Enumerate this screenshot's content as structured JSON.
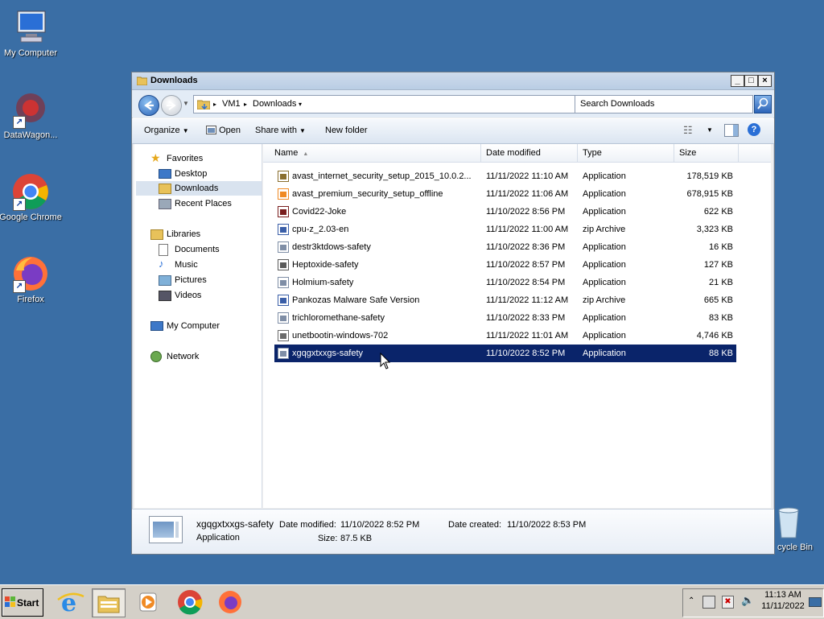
{
  "desktop": {
    "icons": [
      {
        "label": "My Computer"
      },
      {
        "label": "DataWagon..."
      },
      {
        "label": "Google Chrome"
      },
      {
        "label": "Firefox"
      },
      {
        "label": "cycle Bin"
      }
    ]
  },
  "window": {
    "title": "Downloads",
    "address": {
      "root": "VM1",
      "current": "Downloads"
    },
    "search_placeholder": "Search Downloads",
    "toolbar": {
      "organize": "Organize",
      "open": "Open",
      "share_with": "Share with",
      "new_folder": "New folder"
    },
    "nav": {
      "favorites": "Favorites",
      "desktop": "Desktop",
      "downloads": "Downloads",
      "recent_places": "Recent Places",
      "libraries": "Libraries",
      "documents": "Documents",
      "music": "Music",
      "pictures": "Pictures",
      "videos": "Videos",
      "my_computer": "My Computer",
      "network": "Network"
    },
    "columns": {
      "name": "Name",
      "date_modified": "Date modified",
      "type": "Type",
      "size": "Size"
    },
    "files": [
      {
        "name": "avast_internet_security_setup_2015_10.0.2...",
        "date": "11/11/2022 11:10 AM",
        "type": "Application",
        "size": "178,519 KB"
      },
      {
        "name": "avast_premium_security_setup_offline",
        "date": "11/11/2022 11:06 AM",
        "type": "Application",
        "size": "678,915 KB"
      },
      {
        "name": "Covid22-Joke",
        "date": "11/10/2022 8:56 PM",
        "type": "Application",
        "size": "622 KB"
      },
      {
        "name": "cpu-z_2.03-en",
        "date": "11/11/2022 11:00 AM",
        "type": "zip Archive",
        "size": "3,323 KB"
      },
      {
        "name": "destr3ktdows-safety",
        "date": "11/10/2022 8:36 PM",
        "type": "Application",
        "size": "16 KB"
      },
      {
        "name": "Heptoxide-safety",
        "date": "11/10/2022 8:57 PM",
        "type": "Application",
        "size": "127 KB"
      },
      {
        "name": "Holmium-safety",
        "date": "11/10/2022 8:54 PM",
        "type": "Application",
        "size": "21 KB"
      },
      {
        "name": "Pankozas Malware Safe Version",
        "date": "11/11/2022 11:12 AM",
        "type": "zip Archive",
        "size": "665 KB"
      },
      {
        "name": "trichloromethane-safety",
        "date": "11/10/2022 8:33 PM",
        "type": "Application",
        "size": "83 KB"
      },
      {
        "name": "unetbootin-windows-702",
        "date": "11/11/2022 11:01 AM",
        "type": "Application",
        "size": "4,746 KB"
      },
      {
        "name": "xgqgxtxxgs-safety",
        "date": "11/10/2022 8:52 PM",
        "type": "Application",
        "size": "88 KB"
      }
    ],
    "details": {
      "name": "xgqgxtxxgs-safety",
      "type": "Application",
      "date_modified_label": "Date modified:",
      "date_modified": "11/10/2022 8:52 PM",
      "date_created_label": "Date created:",
      "date_created": "11/10/2022 8:53 PM",
      "size_label": "Size:",
      "size": "87.5 KB"
    }
  },
  "taskbar": {
    "start_label": "Start",
    "clock_time": "11:13 AM",
    "clock_date": "11/11/2022"
  },
  "colors": {
    "desktop": "#3a6ea5",
    "selection": "#0a246a"
  }
}
